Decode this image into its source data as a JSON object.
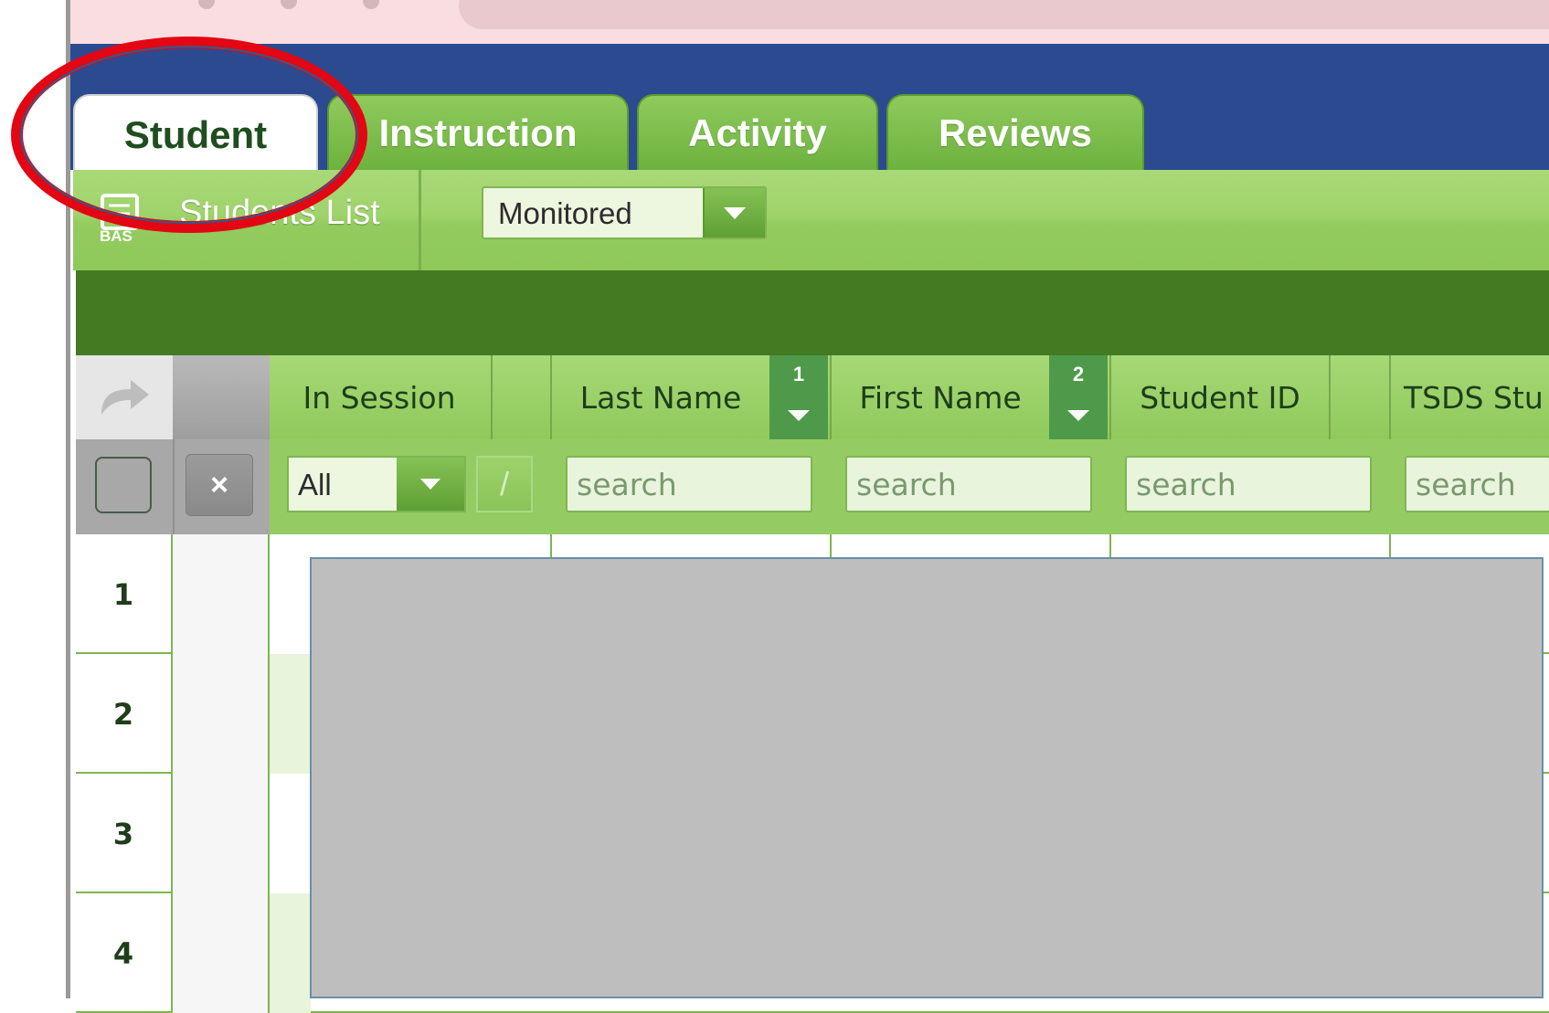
{
  "tabs": [
    {
      "label": "Student",
      "active": true
    },
    {
      "label": "Instruction",
      "active": false
    },
    {
      "label": "Activity",
      "active": false
    },
    {
      "label": "Reviews",
      "active": false
    }
  ],
  "toolbar": {
    "list_label": "Students List",
    "icon_text": "BAS",
    "filter_value": "Monitored"
  },
  "grid": {
    "columns": [
      {
        "label": "In Session"
      },
      {
        "label": "Last Name",
        "sort_order": "1"
      },
      {
        "label": "First Name",
        "sort_order": "2"
      },
      {
        "label": "Student ID"
      },
      {
        "label": "TSDS Stu"
      }
    ],
    "filters": {
      "in_session_value": "All",
      "slash_label": "/",
      "clear_icon": "×",
      "search_placeholder": "search"
    },
    "rows": [
      "1",
      "2",
      "3",
      "4"
    ]
  },
  "colors": {
    "header_blue": "#2c4a8f",
    "tab_green": "#7cbd4b",
    "dark_band": "#437a22",
    "annotation_red": "#e30613"
  }
}
